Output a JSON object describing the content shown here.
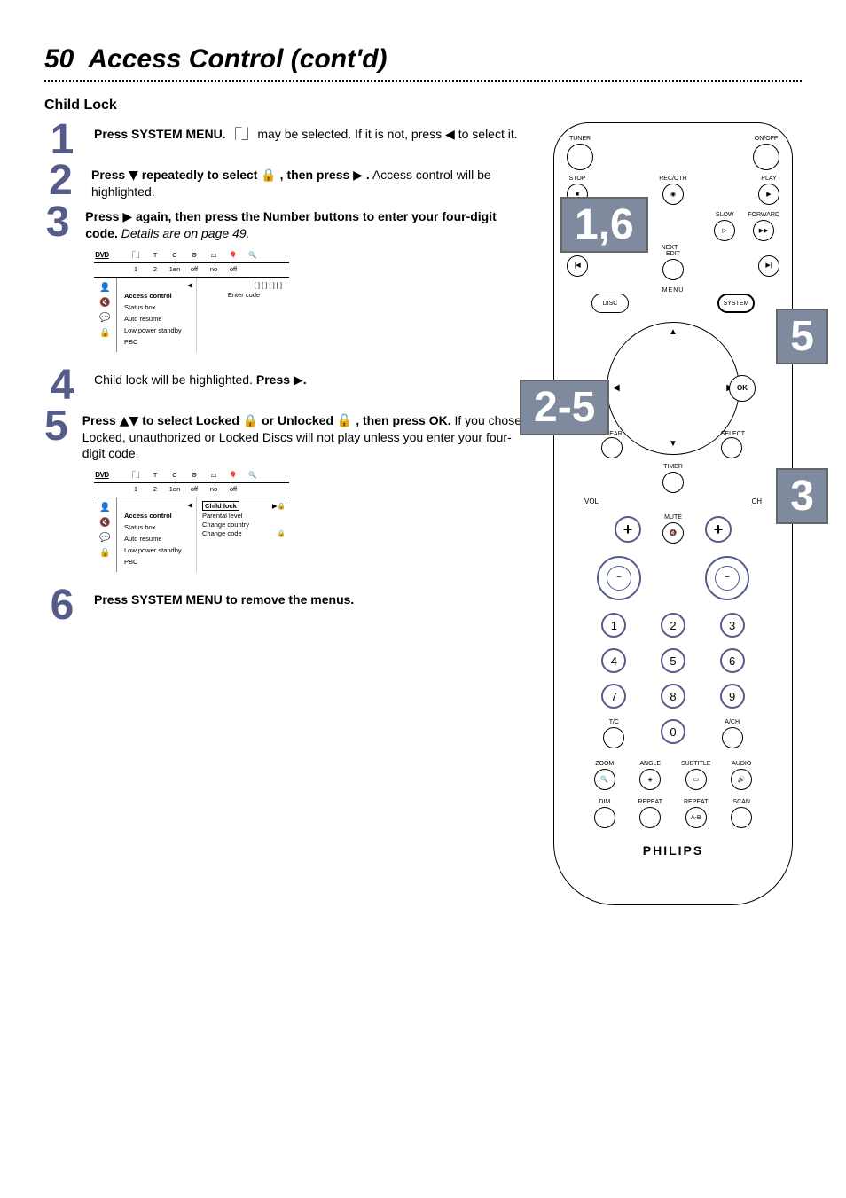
{
  "page_number": "50",
  "page_title": "Access Control (cont'd)",
  "subhead": "Child Lock",
  "steps": {
    "s1": {
      "num": "1",
      "bold": "Press SYSTEM MENU.",
      "rest_a": " may be selected. If it is not, press ",
      "rest_b": " to select it."
    },
    "s2": {
      "num": "2",
      "bold_a": "Press ",
      "bold_b": " repeatedly to select ",
      "bold_c": " , then press ",
      "bold_d": " .",
      "rest": " Access control will be highlighted."
    },
    "s3": {
      "num": "3",
      "bold_a": "Press ",
      "bold_b": " again, then press the Number buttons to enter your four-digit code.",
      "italic": " Details are on page 49."
    },
    "s4": {
      "num": "4",
      "text_a": "Child lock will be highlighted. ",
      "bold": "Press ",
      "bold_end": "."
    },
    "s5": {
      "num": "5",
      "bold_a": "Press ",
      "bold_b": " to select Locked ",
      "bold_c": " or Unlocked ",
      "bold_d": " , then press OK.",
      "rest": " If you chose Locked, unauthorized or Locked Discs will not play unless you enter your four-digit code."
    },
    "s6": {
      "num": "6",
      "bold": "Press SYSTEM MENU to remove the menus."
    }
  },
  "osd_common": {
    "dvd": "DVD",
    "top_icons": [
      "",
      "",
      "T",
      "C",
      "⚙",
      "□",
      "🎈",
      "🔍"
    ],
    "row2": [
      "",
      "",
      "1",
      "2",
      "1en",
      "off",
      "no",
      "off"
    ],
    "left_icons": [
      "👤",
      "🔇",
      "💬",
      "🔒"
    ],
    "menu": {
      "access": "Access control",
      "status": "Status box",
      "resume": "Auto resume",
      "lowpower": "Low power standby",
      "pbc": "PBC"
    }
  },
  "osd1": {
    "code_mask": "[ ] [ ] [ ] [ ]",
    "enter": "Enter code"
  },
  "osd2": {
    "childlock": "Child lock",
    "parental": "Parental level",
    "country": "Change country",
    "code": "Change code"
  },
  "remote": {
    "tuner": "TUNER",
    "onoff": "ON/OFF",
    "stop": "STOP",
    "recotr": "REC/OTR",
    "play": "PLAY",
    "slow": "SLOW",
    "forward": "FORWARD",
    "next": "NEXT",
    "prev_sym": "⦉",
    "edit": "EDIT",
    "next_sym": "⦊",
    "disc": "DISC",
    "menu": "MENU",
    "system": "SYSTEM",
    "ok": "OK",
    "clear": "CLEAR",
    "timer": "TIMER",
    "select": "SELECT",
    "vol": "VOL",
    "ch": "CH",
    "mute": "MUTE",
    "nums": [
      "1",
      "2",
      "3",
      "4",
      "5",
      "6",
      "7",
      "8",
      "9",
      "0"
    ],
    "tc": "T/C",
    "ach": "A/CH",
    "zoom": "ZOOM",
    "angle": "ANGLE",
    "subtitle": "SUBTITLE",
    "audio": "AUDIO",
    "dim": "DIM",
    "repeat": "REPEAT",
    "repeat2": "REPEAT",
    "scan": "SCAN",
    "ab": "A-B",
    "brand": "PHILIPS"
  },
  "callouts": {
    "c16": "1,6",
    "c5": "5",
    "c25": "2-5",
    "c3": "3"
  }
}
